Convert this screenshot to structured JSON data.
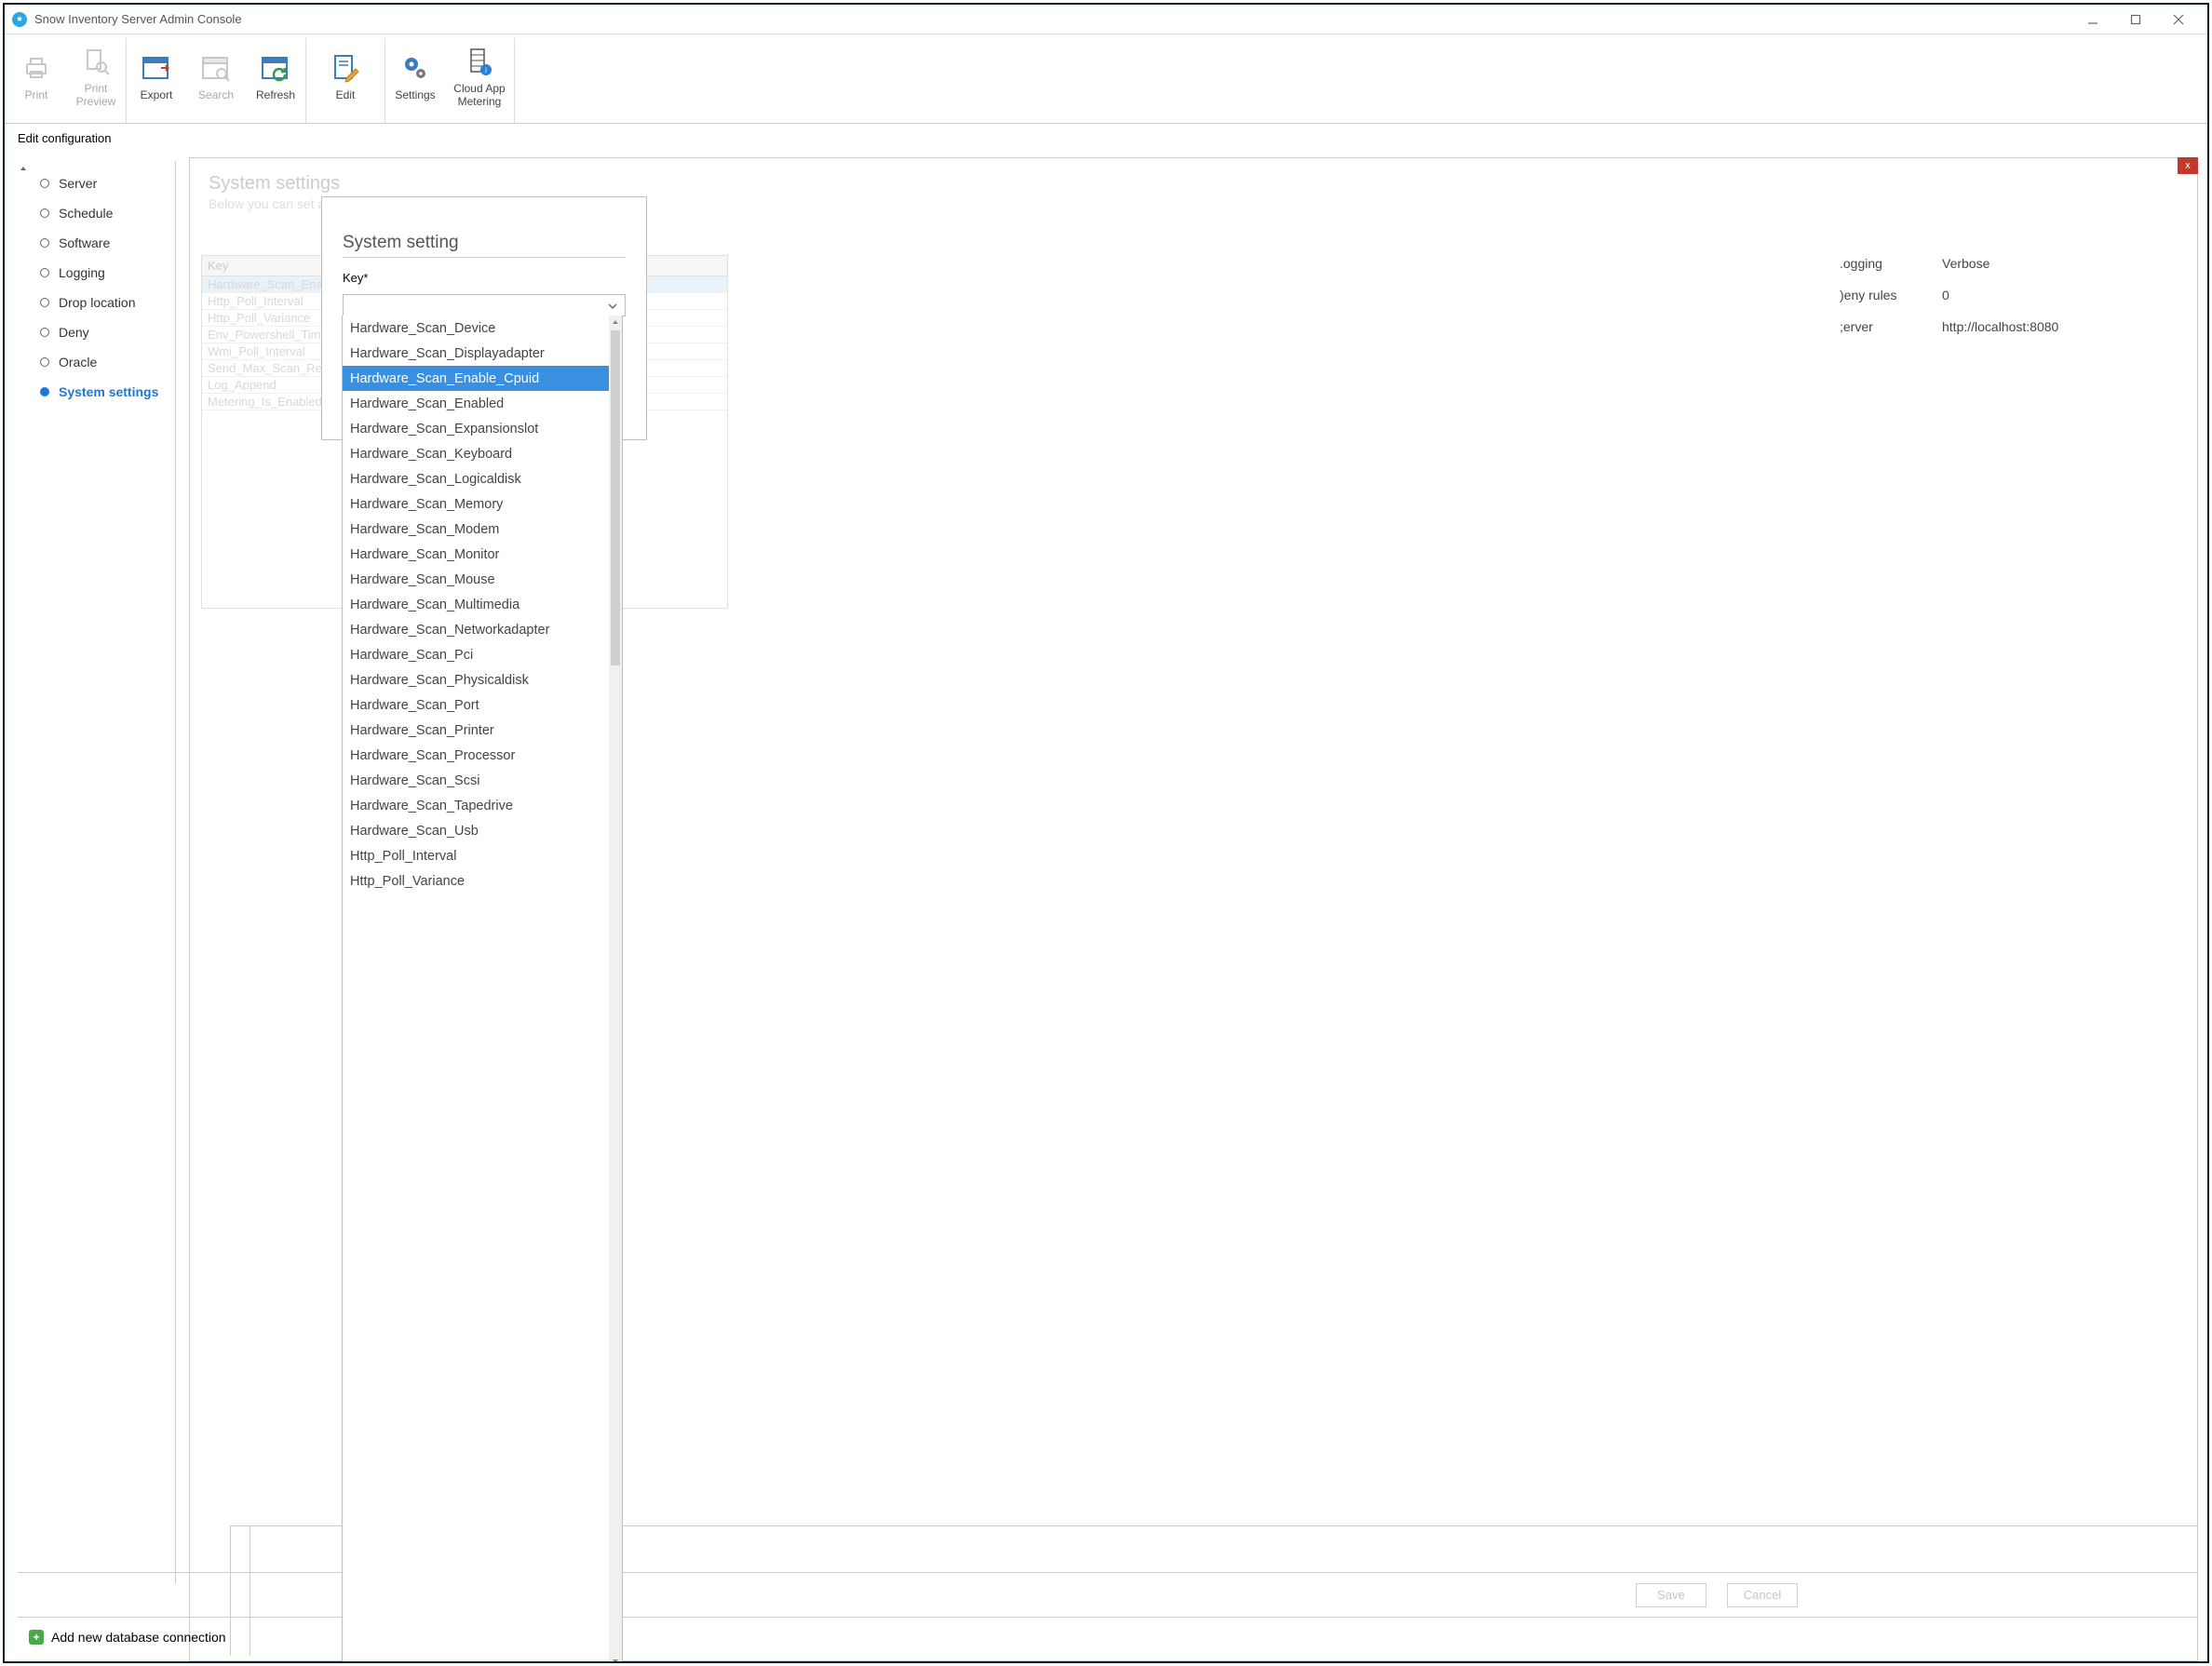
{
  "window": {
    "title": "Snow Inventory Server Admin Console"
  },
  "ribbon": {
    "print": "Print",
    "printPreview": "Print\nPreview",
    "export": "Export",
    "search": "Search",
    "refresh": "Refresh",
    "edit": "Edit",
    "settings": "Settings",
    "cloud": "Cloud App\nMetering"
  },
  "tab": "Edit configuration",
  "sidenav": [
    "Server",
    "Schedule",
    "Software",
    "Logging",
    "Drop location",
    "Deny",
    "Oracle",
    "System settings"
  ],
  "sidenavSelectedIndex": 7,
  "panel": {
    "title": "System settings",
    "subtitle": "Below you can set a …                                                                     …s should be used with caution.",
    "gridHeader": "Key",
    "gridRows": [
      "Hardware_Scan_Enabl…",
      "Http_Poll_Interval",
      "Http_Poll_Variance",
      "Env_Powershell_Timeo…",
      "Wmi_Poll_Interval",
      "Send_Max_Scan_Resu…",
      "Log_Append",
      "Metering_Is_Enabled"
    ],
    "kv": [
      {
        "k": ".ogging",
        "v": "Verbose"
      },
      {
        "k": ")eny rules",
        "v": "0"
      },
      {
        "k": ";erver",
        "v": "http://localhost:8080"
      }
    ]
  },
  "dialog": {
    "title": "System setting",
    "keyLabel": "Key*"
  },
  "dropdown": {
    "selectedIndex": 2,
    "items": [
      "Hardware_Scan_Device",
      "Hardware_Scan_Displayadapter",
      "Hardware_Scan_Enable_Cpuid",
      "Hardware_Scan_Enabled",
      "Hardware_Scan_Expansionslot",
      "Hardware_Scan_Keyboard",
      "Hardware_Scan_Logicaldisk",
      "Hardware_Scan_Memory",
      "Hardware_Scan_Modem",
      "Hardware_Scan_Monitor",
      "Hardware_Scan_Mouse",
      "Hardware_Scan_Multimedia",
      "Hardware_Scan_Networkadapter",
      "Hardware_Scan_Pci",
      "Hardware_Scan_Physicaldisk",
      "Hardware_Scan_Port",
      "Hardware_Scan_Printer",
      "Hardware_Scan_Processor",
      "Hardware_Scan_Scsi",
      "Hardware_Scan_Tapedrive",
      "Hardware_Scan_Usb",
      "Http_Poll_Interval",
      "Http_Poll_Variance"
    ]
  },
  "footer": {
    "save": "Save",
    "cancel": "Cancel"
  },
  "bottom": {
    "addConn": "Add new database connection"
  }
}
